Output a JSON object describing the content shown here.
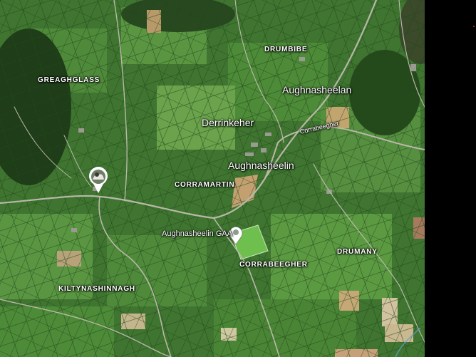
{
  "map": {
    "labels": {
      "drumbibe": "DRUMBIBE",
      "greaghglass": "GREAGHGLASS",
      "aughnasheelan": "Aughnasheelan",
      "derrinkeher": "Derrinkeher",
      "corrabeegher_road": "Corrabeegher",
      "aughnasheelin": "Aughnasheelin",
      "corramartin": "CORRAMARTIN",
      "gaa": "Aughnasheelin GAA",
      "drumany": "DRUMANY",
      "corrabeegher": "CORRABEEGHER",
      "kiltynashinnagh": "KILTYNASHINNAGH"
    },
    "icons": {
      "photo_pin": "photo-pin-icon",
      "place_pin": "place-pin-icon"
    },
    "colors": {
      "field_dark": "#2f5a26",
      "field_light": "#5c9a42",
      "road": "#b8b8a8",
      "label": "#ffffff"
    }
  }
}
